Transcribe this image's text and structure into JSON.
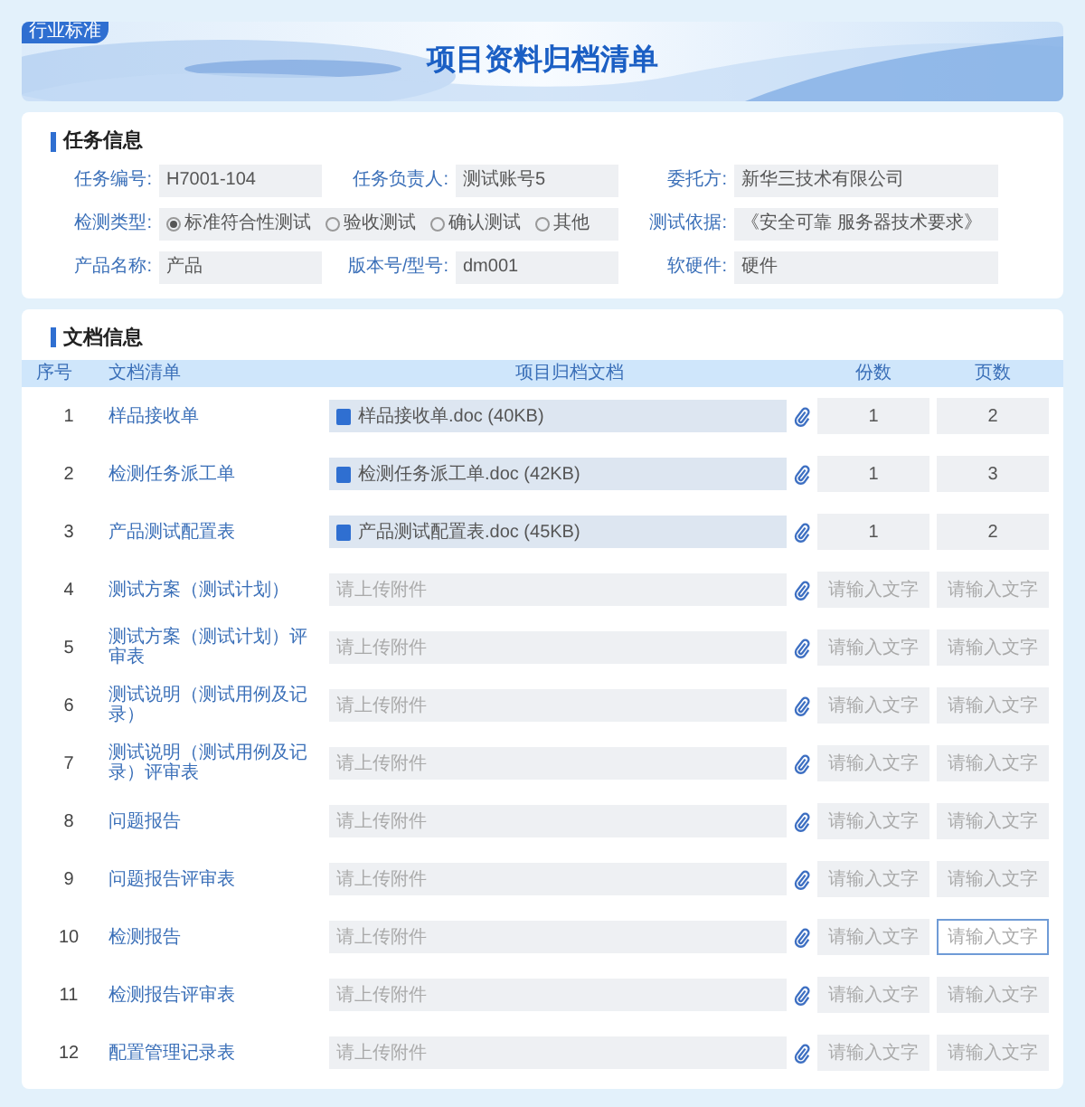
{
  "header": {
    "badge": "行业标准",
    "title": "项目资料归档清单"
  },
  "task_info": {
    "title": "任务信息",
    "fields": [
      {
        "label": "任务编号:",
        "value": "H7001-104"
      },
      {
        "label": "任务负责人:",
        "value": "测试账号5"
      },
      {
        "label": "委托方:",
        "value": "新华三技术有限公司"
      },
      {
        "label": "检测类型:",
        "kind": "radio",
        "options": [
          {
            "label": "标准符合性测试",
            "selected": true
          },
          {
            "label": "验收测试",
            "selected": false
          },
          {
            "label": "确认测试",
            "selected": false
          },
          {
            "label": "其他",
            "selected": false
          }
        ]
      },
      {
        "label": "测试依据:",
        "value": "《安全可靠 服务器技术要求》"
      },
      {
        "label": "产品名称:",
        "value": "产品"
      },
      {
        "label": "版本号/型号:",
        "value": "dm001"
      },
      {
        "label": "软硬件:",
        "value": "硬件"
      }
    ]
  },
  "documents": {
    "title": "文档信息",
    "columns": [
      "序号",
      "文档清单",
      "项目归档文档",
      "份数",
      "页数"
    ],
    "rows": [
      {
        "no": "1",
        "name": "样品接收单",
        "file": {
          "kind": "uploaded",
          "text": "样品接收单.doc (40KB)"
        },
        "copies": {
          "value": "1",
          "focused": false
        },
        "pages": {
          "value": "2",
          "focused": false
        }
      },
      {
        "no": "2",
        "name": "检测任务派工单",
        "file": {
          "kind": "uploaded",
          "text": "检测任务派工单.doc (42KB)"
        },
        "copies": {
          "value": "1",
          "focused": false
        },
        "pages": {
          "value": "3",
          "focused": false
        }
      },
      {
        "no": "3",
        "name": "产品测试配置表",
        "file": {
          "kind": "uploaded",
          "text": "产品测试配置表.doc (45KB)"
        },
        "copies": {
          "value": "1",
          "focused": false
        },
        "pages": {
          "value": "2",
          "focused": false
        }
      },
      {
        "no": "4",
        "name": "测试方案（测试计划）",
        "file": {
          "kind": "empty",
          "text": "请上传附件"
        },
        "copies": {
          "placeholder": "请输入文字",
          "focused": false
        },
        "pages": {
          "placeholder": "请输入文字",
          "focused": false
        }
      },
      {
        "no": "5",
        "name": "测试方案（测试计划）评审表",
        "file": {
          "kind": "empty",
          "text": "请上传附件"
        },
        "copies": {
          "placeholder": "请输入文字",
          "focused": false
        },
        "pages": {
          "placeholder": "请输入文字",
          "focused": false
        }
      },
      {
        "no": "6",
        "name": "测试说明（测试用例及记录）",
        "file": {
          "kind": "empty",
          "text": "请上传附件"
        },
        "copies": {
          "placeholder": "请输入文字",
          "focused": false
        },
        "pages": {
          "placeholder": "请输入文字",
          "focused": false
        }
      },
      {
        "no": "7",
        "name": "测试说明（测试用例及记录）评审表",
        "file": {
          "kind": "empty",
          "text": "请上传附件"
        },
        "copies": {
          "placeholder": "请输入文字",
          "focused": false
        },
        "pages": {
          "placeholder": "请输入文字",
          "focused": false
        }
      },
      {
        "no": "8",
        "name": "问题报告",
        "file": {
          "kind": "empty",
          "text": "请上传附件"
        },
        "copies": {
          "placeholder": "请输入文字",
          "focused": false
        },
        "pages": {
          "placeholder": "请输入文字",
          "focused": false
        }
      },
      {
        "no": "9",
        "name": "问题报告评审表",
        "file": {
          "kind": "empty",
          "text": "请上传附件"
        },
        "copies": {
          "placeholder": "请输入文字",
          "focused": false
        },
        "pages": {
          "placeholder": "请输入文字",
          "focused": false
        }
      },
      {
        "no": "10",
        "name": "检测报告",
        "file": {
          "kind": "empty",
          "text": "请上传附件"
        },
        "copies": {
          "placeholder": "请输入文字",
          "focused": false
        },
        "pages": {
          "placeholder": "请输入文字",
          "focused": true
        }
      },
      {
        "no": "11",
        "name": "检测报告评审表",
        "file": {
          "kind": "empty",
          "text": "请上传附件"
        },
        "copies": {
          "placeholder": "请输入文字",
          "focused": false
        },
        "pages": {
          "placeholder": "请输入文字",
          "focused": false
        }
      },
      {
        "no": "12",
        "name": "配置管理记录表",
        "file": {
          "kind": "empty",
          "text": "请上传附件"
        },
        "copies": {
          "placeholder": "请输入文字",
          "focused": false
        },
        "pages": {
          "placeholder": "请输入文字",
          "focused": false
        }
      }
    ]
  }
}
